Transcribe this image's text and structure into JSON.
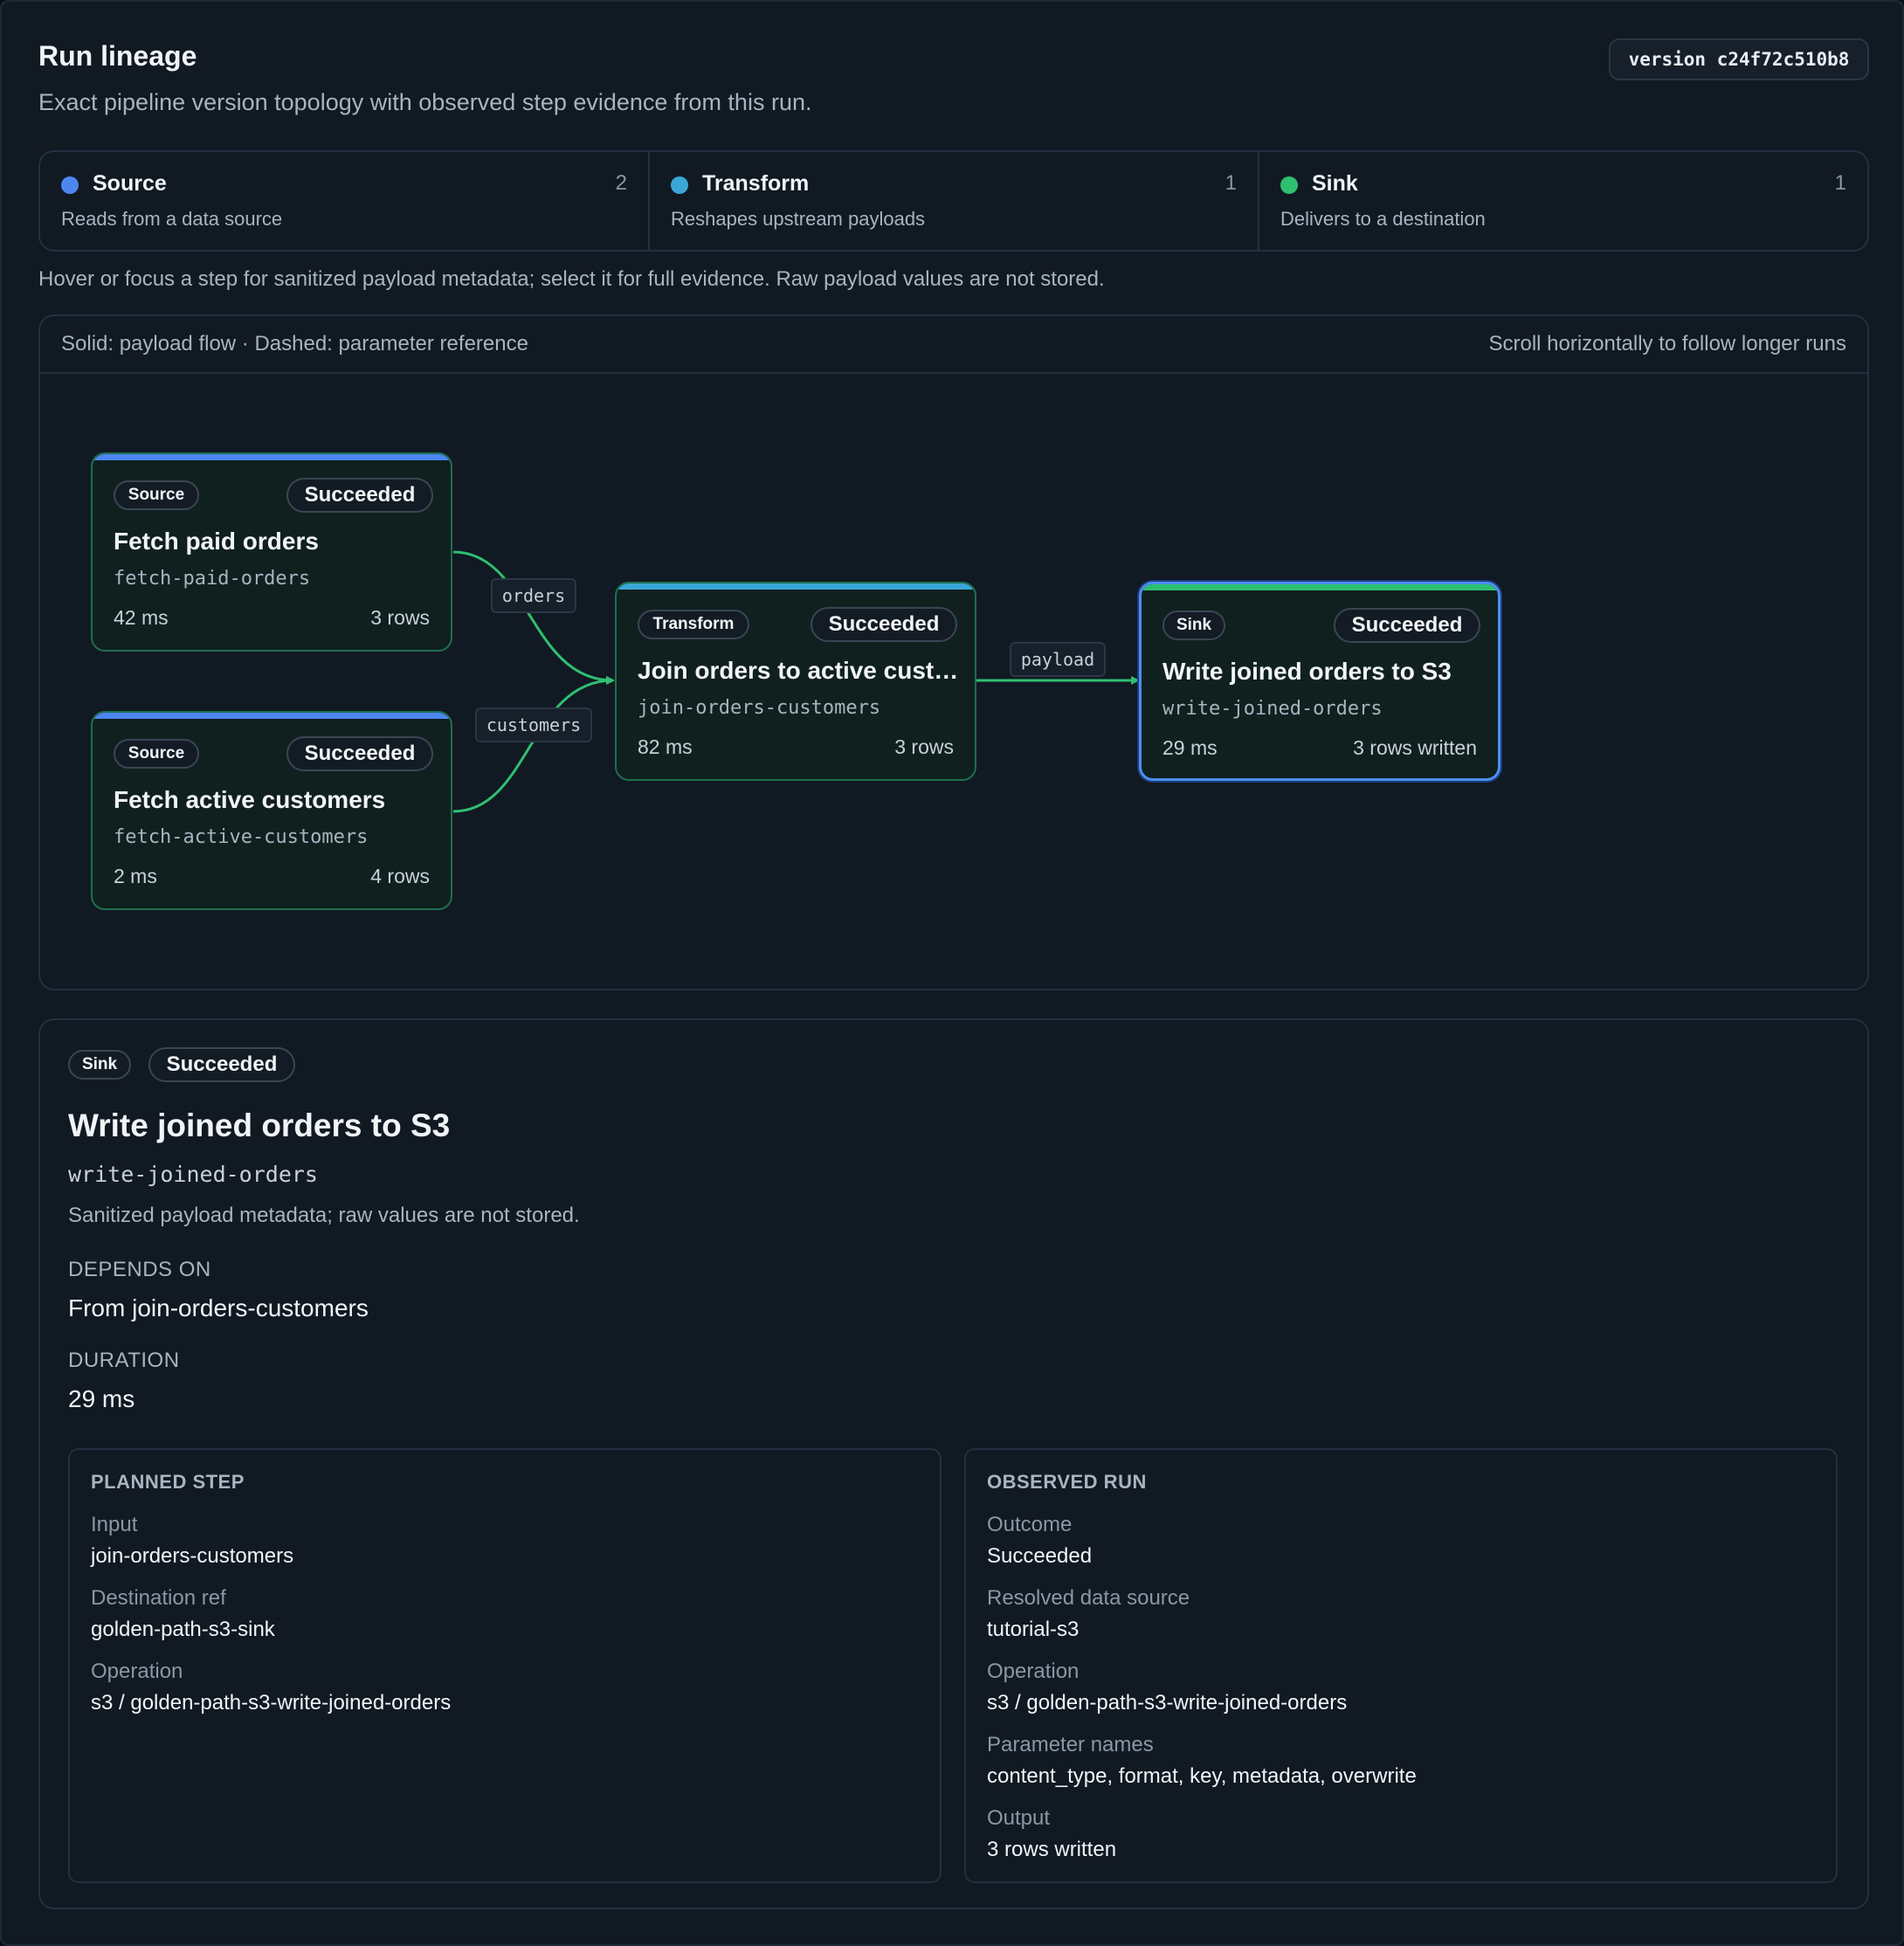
{
  "header": {
    "title": "Run lineage",
    "subtitle": "Exact pipeline version topology with observed step evidence from this run.",
    "version": "version c24f72c510b8"
  },
  "legend": [
    {
      "name": "Source",
      "count": "2",
      "desc": "Reads from a data source",
      "color": "#4d86f0"
    },
    {
      "name": "Transform",
      "count": "1",
      "desc": "Reshapes upstream payloads",
      "color": "#3aa6d8"
    },
    {
      "name": "Sink",
      "count": "1",
      "desc": "Delivers to a destination",
      "color": "#2fbf71"
    }
  ],
  "hint": "Hover or focus a step for sanitized payload metadata; select it for full evidence. Raw payload values are not stored.",
  "graph": {
    "legend_text": "Solid: payload flow · Dashed: parameter reference",
    "scroll_hint": "Scroll horizontally to follow longer runs",
    "nodes": [
      {
        "kind": "Source",
        "status": "Succeeded",
        "title": "Fetch paid orders",
        "id": "fetch-paid-orders",
        "duration": "42 ms",
        "rows": "3 rows"
      },
      {
        "kind": "Source",
        "status": "Succeeded",
        "title": "Fetch active customers",
        "id": "fetch-active-customers",
        "duration": "2 ms",
        "rows": "4 rows"
      },
      {
        "kind": "Transform",
        "status": "Succeeded",
        "title": "Join orders to active cust…",
        "id": "join-orders-customers",
        "duration": "82 ms",
        "rows": "3 rows"
      },
      {
        "kind": "Sink",
        "status": "Succeeded",
        "title": "Write joined orders to S3",
        "id": "write-joined-orders",
        "duration": "29 ms",
        "rows": "3 rows written"
      }
    ],
    "edge_labels": {
      "orders": "orders",
      "customers": "customers",
      "payload": "payload"
    },
    "edge_color": "#2fbf71"
  },
  "detail": {
    "kind": "Sink",
    "status": "Succeeded",
    "title": "Write joined orders to S3",
    "id": "write-joined-orders",
    "note": "Sanitized payload metadata; raw values are not stored.",
    "depends_label": "DEPENDS ON",
    "depends_value": "From join-orders-customers",
    "duration_label": "DURATION",
    "duration_value": "29 ms",
    "planned": {
      "heading": "PLANNED STEP",
      "items": [
        {
          "label": "Input",
          "value": "join-orders-customers"
        },
        {
          "label": "Destination ref",
          "value": "golden-path-s3-sink"
        },
        {
          "label": "Operation",
          "value": "s3 / golden-path-s3-write-joined-orders"
        }
      ]
    },
    "observed": {
      "heading": "OBSERVED RUN",
      "items": [
        {
          "label": "Outcome",
          "value": "Succeeded"
        },
        {
          "label": "Resolved data source",
          "value": "tutorial-s3"
        },
        {
          "label": "Operation",
          "value": "s3 / golden-path-s3-write-joined-orders"
        },
        {
          "label": "Parameter names",
          "value": "content_type, format, key, metadata, overwrite"
        },
        {
          "label": "Output",
          "value": "3 rows written"
        }
      ]
    }
  }
}
